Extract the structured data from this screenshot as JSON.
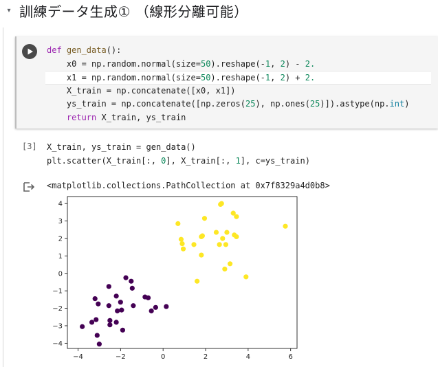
{
  "section": {
    "arrow": "▾",
    "title": "訓練データ生成① （線形分離可能）"
  },
  "cell1": {
    "lines": [
      [
        {
          "t": "def ",
          "c": "kw"
        },
        {
          "t": "gen_data",
          "c": "fn"
        },
        {
          "t": "():",
          "c": ""
        }
      ],
      [
        {
          "t": "    x0 = np.random.normal(size=",
          "c": ""
        },
        {
          "t": "50",
          "c": "num"
        },
        {
          "t": ").reshape(-",
          "c": ""
        },
        {
          "t": "1",
          "c": "num"
        },
        {
          "t": ", ",
          "c": ""
        },
        {
          "t": "2",
          "c": "num"
        },
        {
          "t": ") - ",
          "c": ""
        },
        {
          "t": "2.",
          "c": "num"
        }
      ],
      [
        {
          "t": "    x1 = np.random.normal(size=",
          "c": ""
        },
        {
          "t": "50",
          "c": "num"
        },
        {
          "t": ").reshape(-",
          "c": ""
        },
        {
          "t": "1",
          "c": "num"
        },
        {
          "t": ", ",
          "c": ""
        },
        {
          "t": "2",
          "c": "num"
        },
        {
          "t": ") + ",
          "c": ""
        },
        {
          "t": "2.",
          "c": "num"
        }
      ],
      [
        {
          "t": "    X_train = np.concatenate([x0, x1])",
          "c": ""
        }
      ],
      [
        {
          "t": "    ys_train = np.concatenate([np.zeros(",
          "c": ""
        },
        {
          "t": "25",
          "c": "num"
        },
        {
          "t": "), np.ones(",
          "c": ""
        },
        {
          "t": "25",
          "c": "num"
        },
        {
          "t": ")]).astype(np.",
          "c": ""
        },
        {
          "t": "int",
          "c": "builtin"
        },
        {
          "t": ")",
          "c": ""
        }
      ],
      [
        {
          "t": "    ",
          "c": ""
        },
        {
          "t": "return",
          "c": "kw"
        },
        {
          "t": " X_train, ys_train",
          "c": ""
        }
      ]
    ]
  },
  "cell2": {
    "exec_count": "[3]",
    "lines": [
      [
        {
          "t": "X_train, ys_train = gen_data()",
          "c": ""
        }
      ],
      [
        {
          "t": "plt.scatter(X_train[:, ",
          "c": ""
        },
        {
          "t": "0",
          "c": "num"
        },
        {
          "t": "], X_train[:, ",
          "c": ""
        },
        {
          "t": "1",
          "c": "num"
        },
        {
          "t": "], c=ys_train)",
          "c": ""
        }
      ]
    ]
  },
  "output": {
    "text": "<matplotlib.collections.PathCollection at 0x7f8329a4d0b8>"
  },
  "chart_data": {
    "type": "scatter",
    "title": "",
    "xlabel": "",
    "ylabel": "",
    "xlim": [
      -4.5,
      6.3
    ],
    "ylim": [
      -4.3,
      4.4
    ],
    "xticks": [
      -4,
      -2,
      0,
      2,
      4,
      6
    ],
    "yticks": [
      -4,
      -3,
      -2,
      -1,
      0,
      1,
      2,
      3,
      4
    ],
    "grid": false,
    "series": [
      {
        "color": "#440154",
        "points": [
          [
            -3.8,
            -3.05
          ],
          [
            -3.35,
            -2.8
          ],
          [
            -3.15,
            -2.65
          ],
          [
            -3.2,
            -1.45
          ],
          [
            -3.05,
            -1.75
          ],
          [
            -3.1,
            -3.55
          ],
          [
            -3.0,
            -4.05
          ],
          [
            -2.55,
            -0.75
          ],
          [
            -2.55,
            -1.85
          ],
          [
            -2.5,
            -2.7
          ],
          [
            -2.5,
            -2.95
          ],
          [
            -2.2,
            -2.8
          ],
          [
            -2.2,
            -1.3
          ],
          [
            -2.15,
            -2.15
          ],
          [
            -2.0,
            -1.65
          ],
          [
            -1.95,
            -2.1
          ],
          [
            -1.9,
            -3.25
          ],
          [
            -1.75,
            -0.25
          ],
          [
            -1.5,
            -0.45
          ],
          [
            -1.45,
            -0.85
          ],
          [
            -1.4,
            -1.85
          ],
          [
            -0.85,
            -1.35
          ],
          [
            -0.7,
            -1.4
          ],
          [
            -0.55,
            -2.15
          ],
          [
            -0.35,
            -1.95
          ],
          [
            0.15,
            -1.9
          ]
        ]
      },
      {
        "color": "#fde725",
        "points": [
          [
            0.7,
            2.85
          ],
          [
            0.85,
            1.95
          ],
          [
            0.9,
            1.7
          ],
          [
            0.95,
            1.4
          ],
          [
            1.45,
            1.65
          ],
          [
            1.6,
            -0.45
          ],
          [
            1.8,
            2.1
          ],
          [
            1.8,
            1.05
          ],
          [
            1.85,
            2.15
          ],
          [
            1.95,
            3.15
          ],
          [
            2.5,
            2.35
          ],
          [
            2.65,
            1.65
          ],
          [
            2.7,
            3.95
          ],
          [
            2.75,
            4.0
          ],
          [
            2.8,
            2.0
          ],
          [
            2.9,
            0.25
          ],
          [
            2.95,
            1.65
          ],
          [
            3.0,
            2.35
          ],
          [
            3.15,
            0.55
          ],
          [
            3.3,
            3.45
          ],
          [
            3.35,
            2.2
          ],
          [
            3.45,
            2.1
          ],
          [
            3.45,
            3.25
          ],
          [
            3.9,
            -0.2
          ],
          [
            5.75,
            2.7
          ]
        ]
      }
    ]
  }
}
